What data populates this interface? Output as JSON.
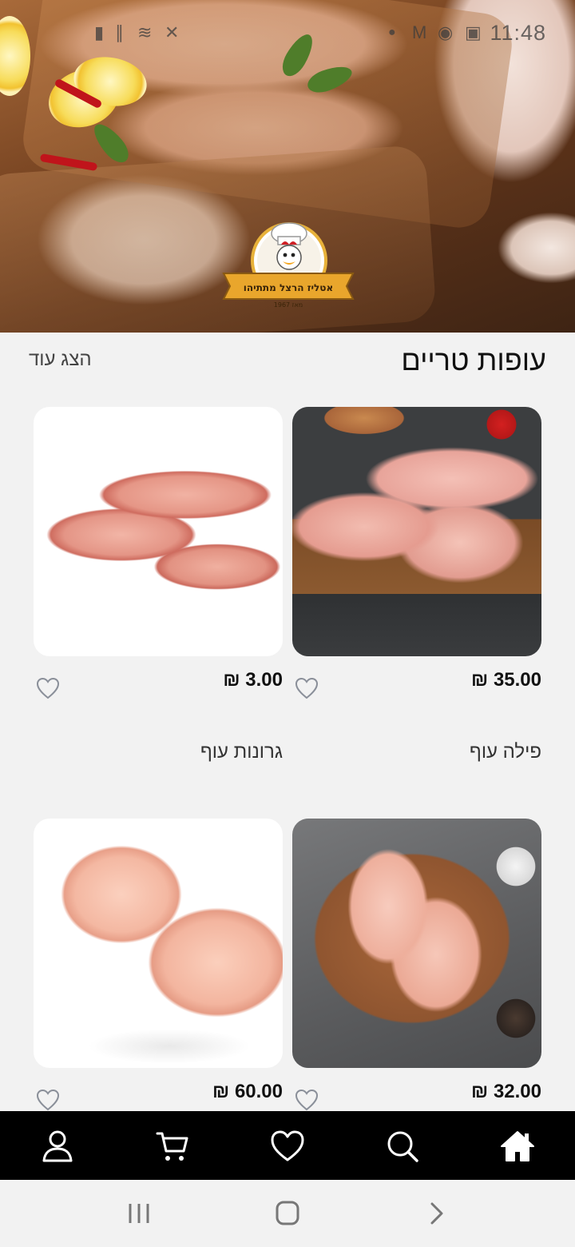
{
  "status_bar": {
    "time": "11:48",
    "left_icons": [
      "battery-icon",
      "signal-icon",
      "wifi-icon",
      "mute-icon"
    ],
    "right_icons": [
      "dot-icon",
      "mail-icon",
      "app-icon",
      "image-icon"
    ]
  },
  "hero": {
    "logo_text": "אטליז הרצל מתתיהו",
    "logo_subtext": "מאז 1967"
  },
  "section": {
    "title": "עופות טריים",
    "show_more": "הצג עוד"
  },
  "products": [
    {
      "name": "פילה עוף",
      "price": "35.00 ₪",
      "image": "chicken-fillet-image",
      "favorite": false
    },
    {
      "name": "גרונות עוף",
      "price": "3.00 ₪",
      "image": "chicken-necks-image",
      "favorite": false
    },
    {
      "name": "",
      "price": "32.00 ₪",
      "image": "chicken-breast-image",
      "favorite": false
    },
    {
      "name": "",
      "price": "60.00 ₪",
      "image": "chicken-thigh-image",
      "favorite": false
    }
  ],
  "bottom_nav": {
    "items": [
      "home-icon",
      "search-icon",
      "heart-icon",
      "cart-icon",
      "user-icon"
    ],
    "background": "#000000",
    "icon_color": "#ffffff"
  },
  "system_nav": {
    "buttons": [
      "recent-apps-icon",
      "home-button-icon",
      "back-icon"
    ]
  }
}
